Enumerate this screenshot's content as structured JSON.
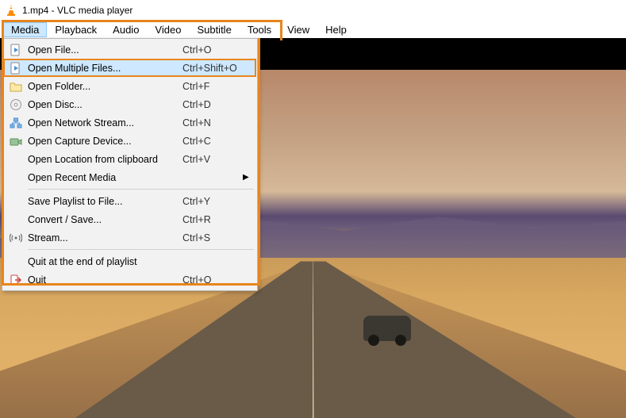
{
  "title": "1.mp4 - VLC media player",
  "menubar": {
    "items": [
      "Media",
      "Playback",
      "Audio",
      "Video",
      "Subtitle",
      "Tools",
      "View",
      "Help"
    ],
    "active_index": 0
  },
  "dropdown": {
    "groups": [
      [
        {
          "icon": "file-play",
          "label": "Open File...",
          "shortcut": "Ctrl+O"
        },
        {
          "icon": "file-play",
          "label": "Open Multiple Files...",
          "shortcut": "Ctrl+Shift+O",
          "highlighted": true
        },
        {
          "icon": "folder",
          "label": "Open Folder...",
          "shortcut": "Ctrl+F"
        },
        {
          "icon": "disc",
          "label": "Open Disc...",
          "shortcut": "Ctrl+D"
        },
        {
          "icon": "network",
          "label": "Open Network Stream...",
          "shortcut": "Ctrl+N"
        },
        {
          "icon": "capture",
          "label": "Open Capture Device...",
          "shortcut": "Ctrl+C"
        },
        {
          "icon": "",
          "label": "Open Location from clipboard",
          "shortcut": "Ctrl+V"
        },
        {
          "icon": "",
          "label": "Open Recent Media",
          "shortcut": "",
          "submenu": true
        }
      ],
      [
        {
          "icon": "",
          "label": "Save Playlist to File...",
          "shortcut": "Ctrl+Y"
        },
        {
          "icon": "",
          "label": "Convert / Save...",
          "shortcut": "Ctrl+R"
        },
        {
          "icon": "stream",
          "label": "Stream...",
          "shortcut": "Ctrl+S"
        }
      ],
      [
        {
          "icon": "",
          "label": "Quit at the end of playlist",
          "shortcut": ""
        },
        {
          "icon": "quit",
          "label": "Quit",
          "shortcut": "Ctrl+Q"
        }
      ]
    ]
  }
}
